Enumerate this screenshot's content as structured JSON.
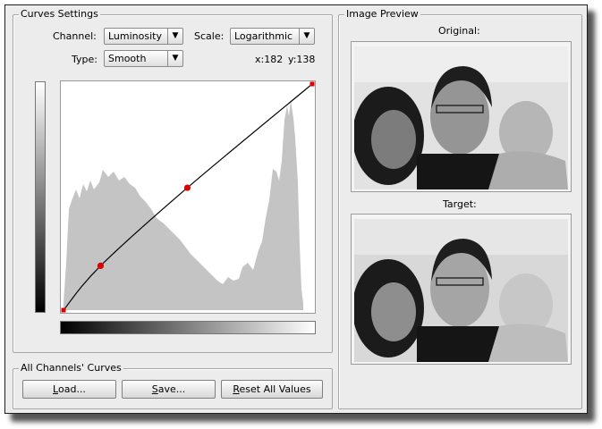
{
  "curves": {
    "title": "Curves Settings",
    "channel_label": "Channel:",
    "channel_value": "Luminosity",
    "scale_label": "Scale:",
    "scale_value": "Logarithmic",
    "type_label": "Type:",
    "type_value": "Smooth",
    "x_readout": "x:182",
    "y_readout": "y:138",
    "points": [
      [
        0,
        0
      ],
      [
        38,
        50
      ],
      [
        127,
        138
      ],
      [
        255,
        255
      ]
    ]
  },
  "channels": {
    "title": "All Channels' Curves",
    "load_prefix": "",
    "load_mnemonic": "L",
    "load_rest": "oad...",
    "save_prefix": "",
    "save_mnemonic": "S",
    "save_rest": "ave...",
    "reset_prefix": "",
    "reset_mnemonic": "R",
    "reset_rest": "eset All Values"
  },
  "preview": {
    "title": "Image Preview",
    "original_label": "Original:",
    "target_label": "Target:"
  },
  "colors": {
    "control_point": "#dd0000",
    "histogram": "#c4c4c4",
    "curve": "#000000"
  }
}
